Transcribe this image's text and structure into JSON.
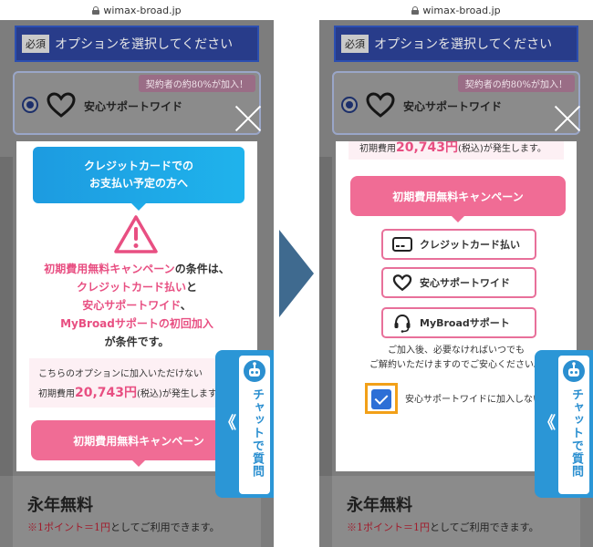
{
  "url": "wimax-broad.jp",
  "background": {
    "required_badge": "必須",
    "header_title": "オプションを選択してください",
    "option_badge": "契約者の約80%が加入！",
    "option_label": "安心サポートワイド",
    "bottom_title": "永年無料",
    "bottom_text_red": "※1ポイント＝1円",
    "bottom_text": "としてご利用できます。"
  },
  "left_modal": {
    "speech_line1": "クレジットカードでの",
    "speech_line2": "お支払い予定の方へ",
    "cond_line1_pink": "初期費用無料キャンペーン",
    "cond_line1_rest": "の条件は、",
    "cond_line2_pink": "クレジットカード払い",
    "cond_line2_rest": "と",
    "cond_line3_pink": "安心サポートワイド",
    "cond_line3_rest": "、",
    "cond_line4_pink": "MyBroadサポートの初回加入",
    "cond_line5": "が条件です。",
    "note_line1": "こちらのオプションに加入いただけない",
    "note_prefix": "初期費用",
    "note_amount": "20,743円",
    "note_suffix": "(税込)が発生します。",
    "campaign_button": "初期費用無料キャンペーン"
  },
  "right_modal": {
    "note_prefix": "初期費用",
    "note_amount": "20,743円",
    "note_suffix": "(税込)が発生します。",
    "campaign_button": "初期費用無料キャンペーン",
    "items": [
      {
        "label": "クレジットカード払い",
        "icon": "credit-card-icon"
      },
      {
        "label": "安心サポートワイド",
        "icon": "heart-icon"
      },
      {
        "label": "MyBroadサポート",
        "icon": "headset-icon"
      }
    ],
    "note_line1": "ご加入後、必要なければいつでも",
    "note_line2": "ご解約いただけますのでご安心ください。",
    "checkbox_label": "安心サポートワイドに加入しない"
  },
  "chat": {
    "label": "チャットで質問",
    "chevron": "《"
  },
  "colors": {
    "pink": "#e84f82",
    "blue": "#1d9be0",
    "navy": "#283c8a",
    "highlight": "#f2a018",
    "chat_blue": "#2b96d6"
  }
}
